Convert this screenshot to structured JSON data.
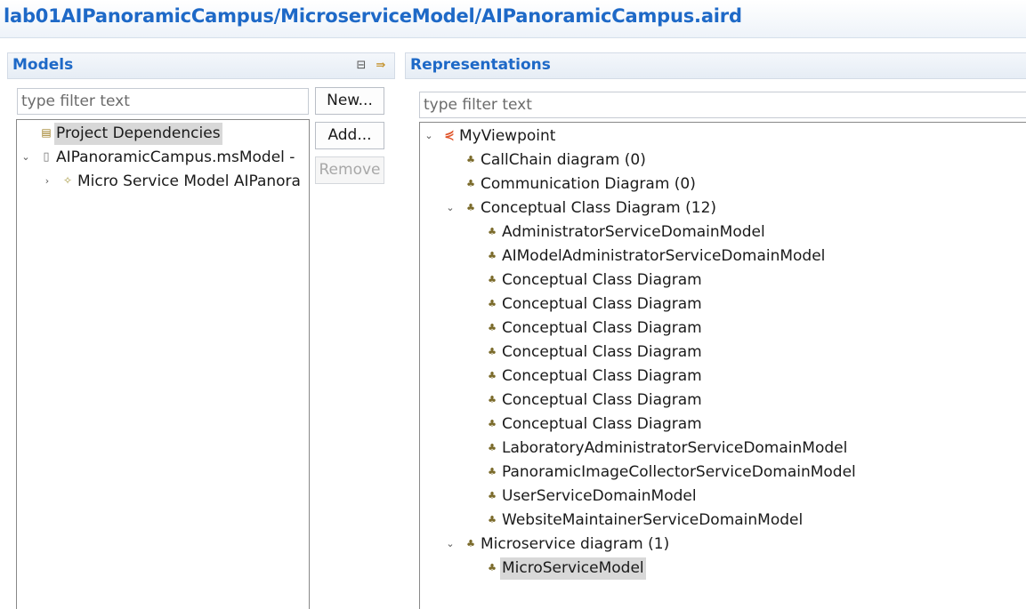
{
  "window": {
    "title": "lab01AIPanoramicCampus/MicroserviceModel/AIPanoramicCampus.aird"
  },
  "models": {
    "header": "Models",
    "toolbar_icons": [
      "collapse-all-icon",
      "link-with-editor-icon"
    ],
    "filter_placeholder": "type filter text",
    "buttons": {
      "new": "New...",
      "add": "Add...",
      "remove": "Remove"
    },
    "tree": [
      {
        "label": "Project Dependencies",
        "icon": "project-dependencies-icon",
        "selected": true
      },
      {
        "label": "AIPanoramicCampus.msModel -",
        "icon": "model-file-icon",
        "expanded": true
      },
      {
        "label": "Micro Service Model AIPanora",
        "icon": "model-element-icon",
        "collapsed": true
      }
    ]
  },
  "representations": {
    "header": "Representations",
    "filter_placeholder": "type filter text",
    "viewpoint": "MyViewpoint",
    "types": {
      "callchain": "CallChain diagram (0)",
      "communication": "Communication Diagram (0)",
      "conceptual": "Conceptual Class Diagram (12)",
      "microservice": "Microservice diagram (1)"
    },
    "conceptual_items": [
      "AdministratorServiceDomainModel",
      "AIModelAdministratorServiceDomainModel",
      "Conceptual Class Diagram",
      "Conceptual Class Diagram",
      "Conceptual Class Diagram",
      "Conceptual Class Diagram",
      "Conceptual Class Diagram",
      "Conceptual Class Diagram",
      "Conceptual Class Diagram",
      "LaboratoryAdministratorServiceDomainModel",
      "PanoramicImageCollectorServiceDomainModel",
      "UserServiceDomainModel",
      "WebsiteMaintainerServiceDomainModel"
    ],
    "microservice_items": [
      "MicroServiceModel"
    ]
  },
  "colors": {
    "accent": "#1e69c7",
    "selection": "#d8d8d8"
  }
}
